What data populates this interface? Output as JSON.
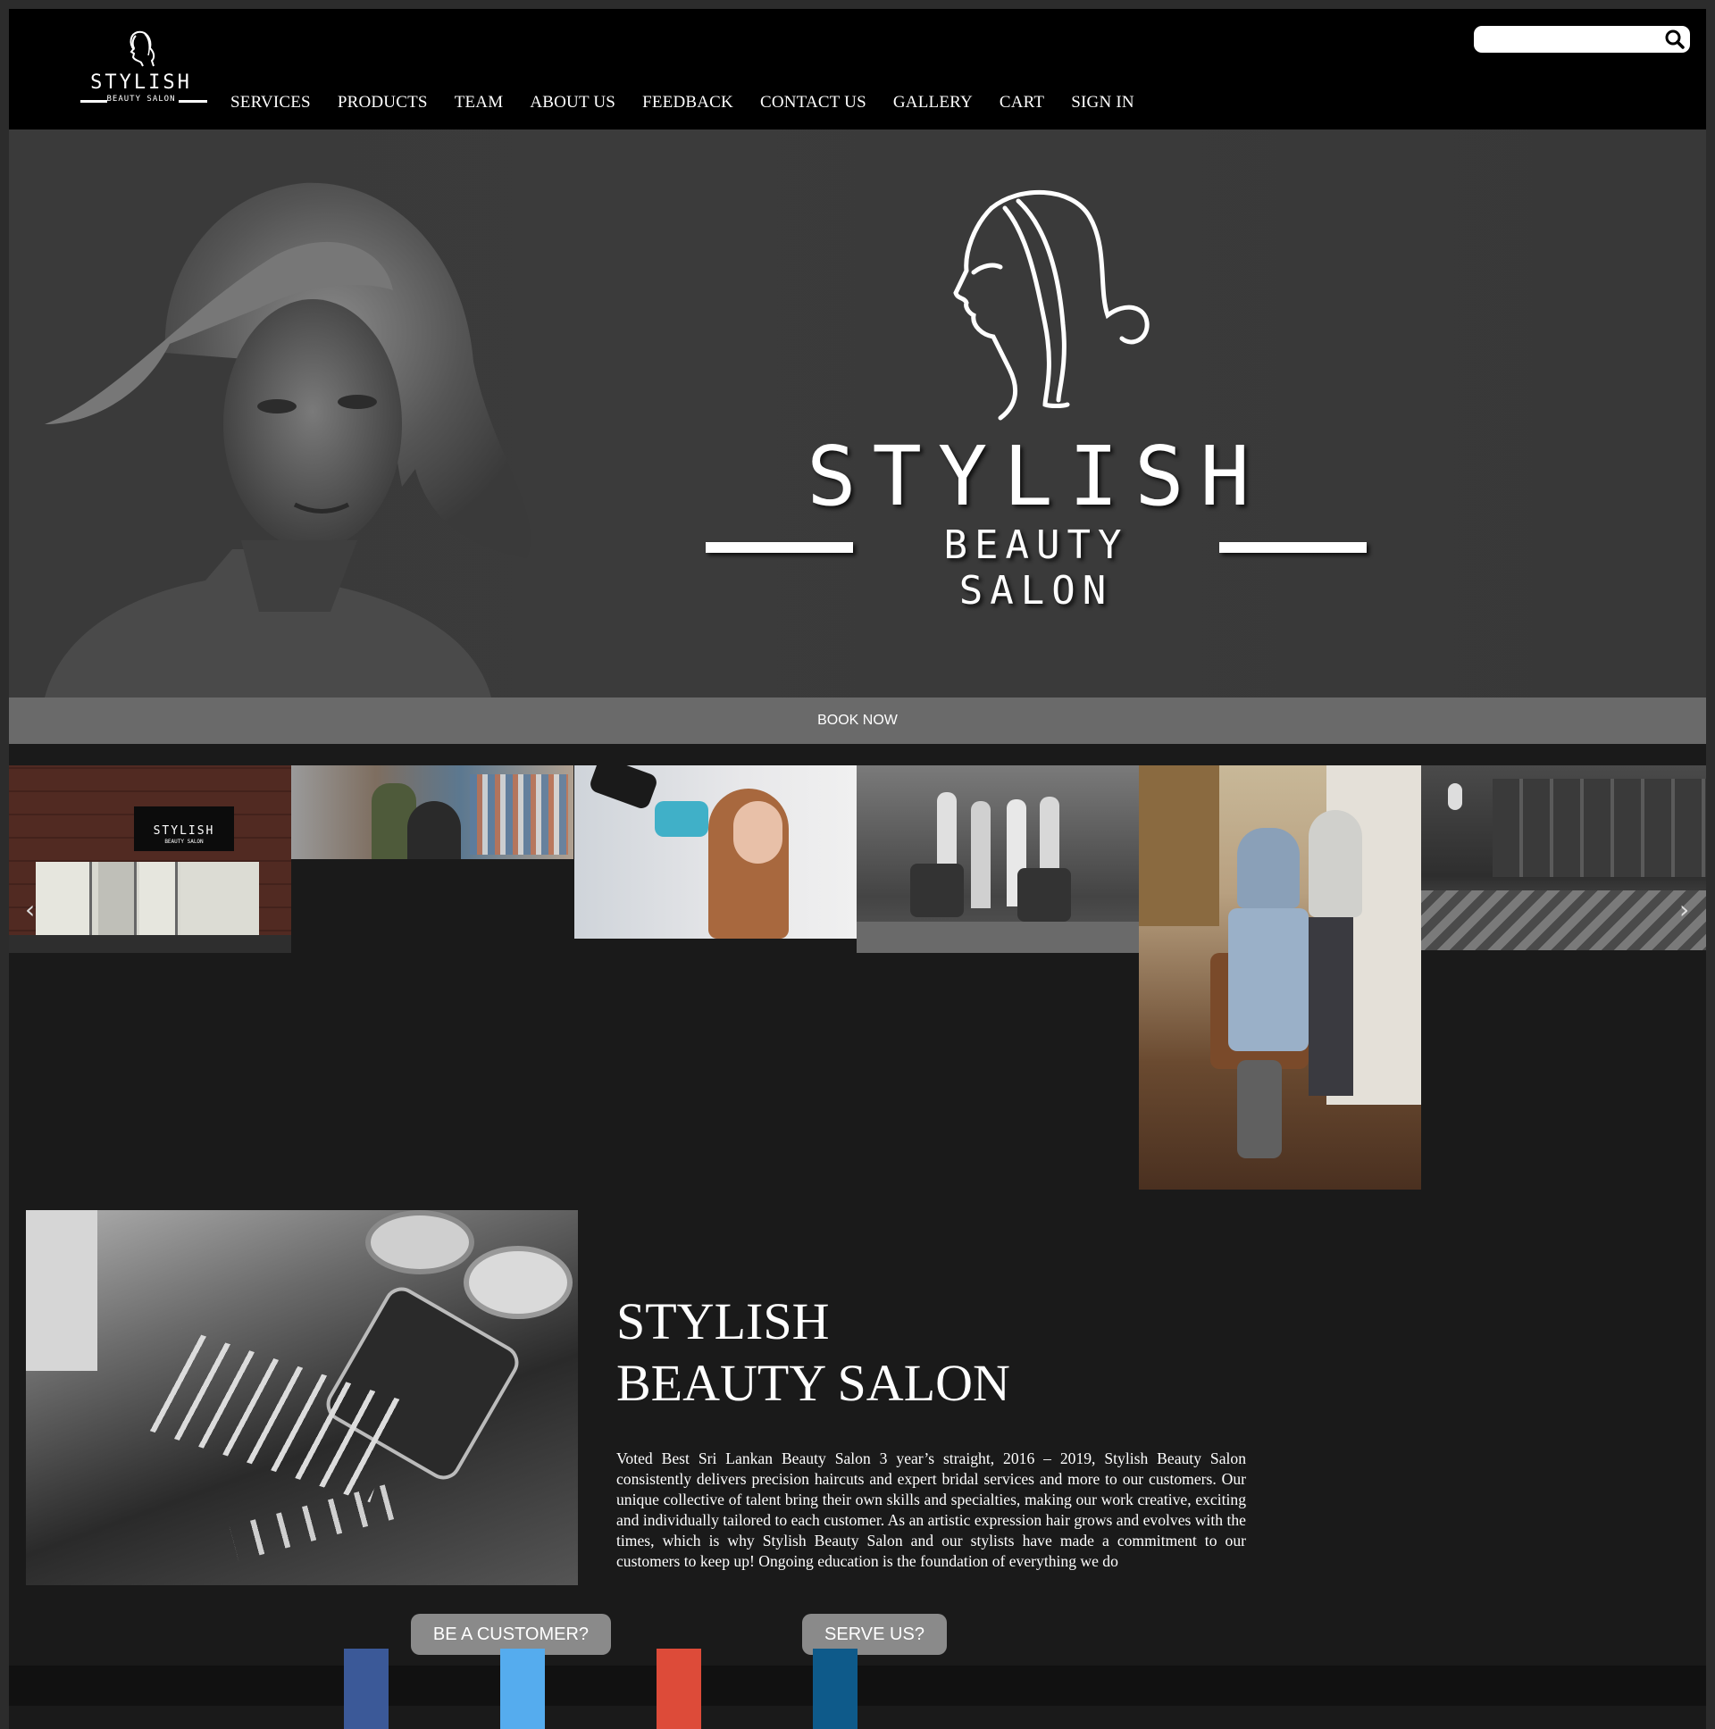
{
  "header": {
    "logo": {
      "brand": "STYLISH",
      "sub": "BEAUTY SALON"
    },
    "nav": [
      {
        "label": "SERVICES"
      },
      {
        "label": "PRODUCTS"
      },
      {
        "label": "TEAM"
      },
      {
        "label": "ABOUT US"
      },
      {
        "label": "FEEDBACK"
      },
      {
        "label": "CONTACT US"
      },
      {
        "label": "GALLERY"
      },
      {
        "label": "CART"
      },
      {
        "label": "SIGN IN"
      }
    ],
    "search": {
      "value": "",
      "placeholder": ""
    }
  },
  "hero": {
    "brand": "STYLISH",
    "sub": "BEAUTY SALON",
    "book_label": "BOOK NOW"
  },
  "gallery": {
    "storefront_sign": {
      "brand": "STYLISH",
      "sub": "BEAUTY SALON"
    },
    "prev_arrow": "‹",
    "next_arrow": "›"
  },
  "about": {
    "title_line1": "STYLISH",
    "title_line2": "BEAUTY SALON",
    "text": "Voted Best Sri Lankan Beauty Salon 3 year’s straight, 2016 – 2019, Stylish Beauty Salon consistently delivers precision haircuts and expert bridal services and more to our customers. Our unique collective of talent bring their own skills and specialties, making our work creative, exciting and individually tailored to each customer. As an artistic expression hair grows and evolves with the times, which is why Stylish Beauty Salon and our stylists have made a commitment to our customers to keep up! Ongoing education is the foundation of everything we do"
  },
  "cta": {
    "customer_label": "BE A CUSTOMER?",
    "serve_label": "SERVE US?"
  },
  "social": [
    {
      "name": "facebook",
      "color": "#3b5998"
    },
    {
      "name": "twitter",
      "color": "#55acee"
    },
    {
      "name": "google-plus",
      "color": "#dd4b39"
    },
    {
      "name": "linkedin",
      "color": "#0e5a8a"
    }
  ]
}
